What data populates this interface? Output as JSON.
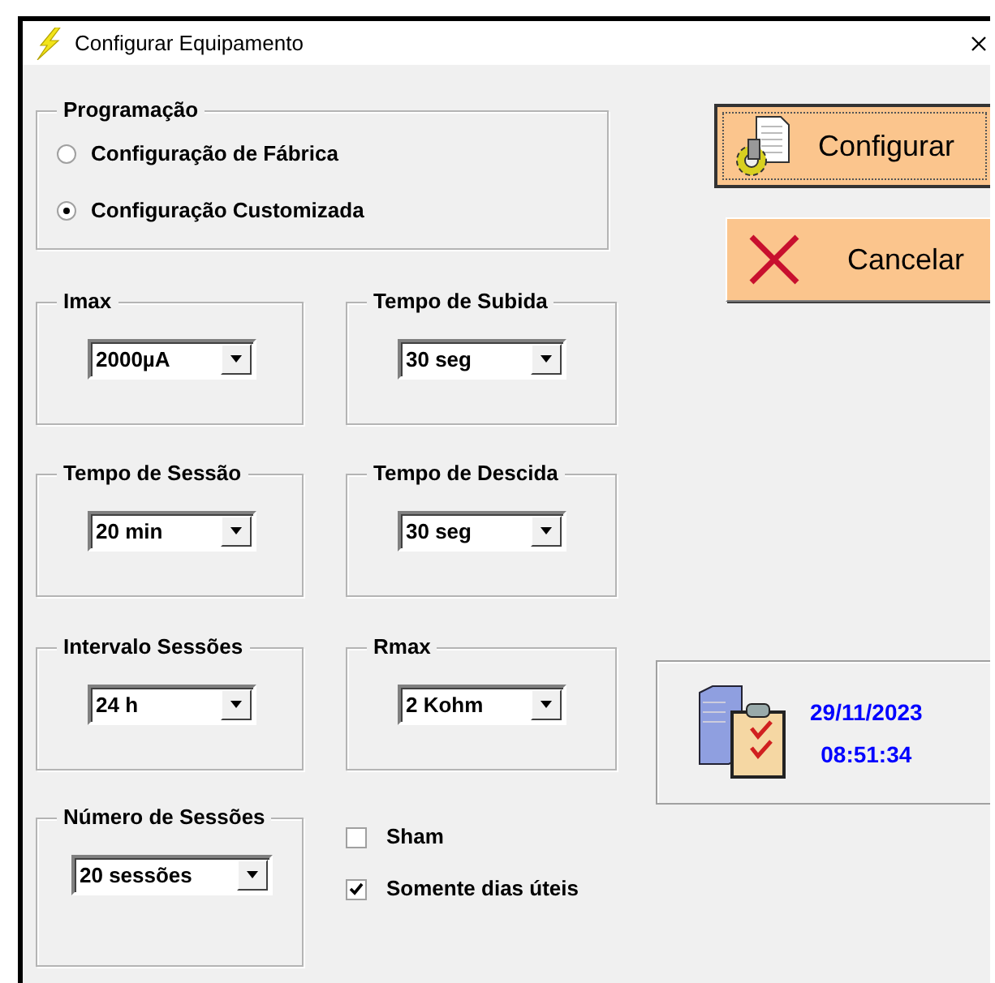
{
  "window": {
    "title": "Configurar Equipamento"
  },
  "programming": {
    "label": "Programação",
    "options": [
      {
        "label": "Configuração de Fábrica",
        "selected": false
      },
      {
        "label": "Configuração Customizada",
        "selected": true
      }
    ]
  },
  "buttons": [
    {
      "label": "Configurar",
      "kind": "configure",
      "focused": true
    },
    {
      "label": "Cancelar",
      "kind": "cancel",
      "focused": false
    }
  ],
  "settings": [
    {
      "label": "Imax",
      "value": "2000µA"
    },
    {
      "label": "Tempo de Subida",
      "value": "30 seg"
    },
    {
      "label": "Tempo de Sessão",
      "value": "20 min"
    },
    {
      "label": "Tempo de Descida",
      "value": "30 seg"
    },
    {
      "label": "Intervalo Sessões",
      "value": "24 h"
    },
    {
      "label": "Rmax",
      "value": "2 Kohm"
    }
  ],
  "clock": {
    "date": "29/11/2023",
    "time": "08:51:34"
  },
  "session_count": {
    "label": "Número de Sessões",
    "value": "20 sessões"
  },
  "options": [
    {
      "label": "Sham",
      "checked": false
    },
    {
      "label": "Somente dias úteis",
      "checked": true
    }
  ]
}
